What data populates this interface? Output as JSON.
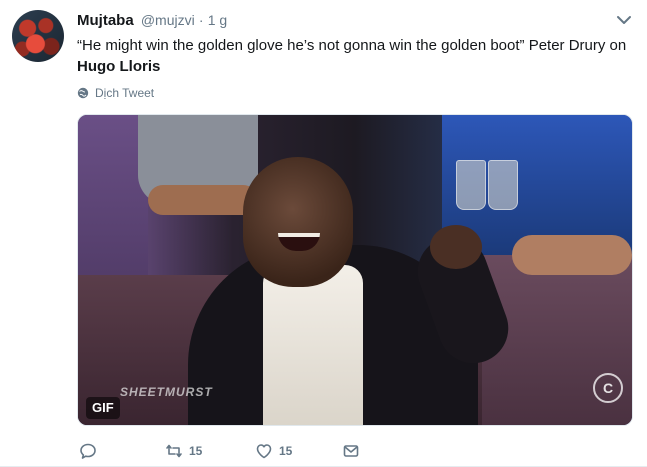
{
  "tweet": {
    "author_name": "Mujtaba",
    "handle": "@mujzvi",
    "separator": "·",
    "time": "1 g",
    "text_main": "“He might win the golden glove he’s not gonna win the golden boot” Peter Drury on ",
    "text_bold": "Hugo Lloris",
    "translate_label": "Dịch Tweet",
    "media": {
      "badge": "GIF",
      "watermark": "SHEETMURST",
      "channel_logo": "C"
    },
    "actions": {
      "reply_count": "",
      "retweet_count": "15",
      "like_count": "15"
    }
  },
  "icons": {
    "caret": "chevron-down-icon",
    "translate": "globe-icon",
    "reply": "reply-icon",
    "retweet": "retweet-icon",
    "like": "heart-icon",
    "dm": "envelope-icon"
  },
  "colors": {
    "text": "#14171a",
    "secondary": "#657786",
    "border": "#e6ecf0"
  }
}
